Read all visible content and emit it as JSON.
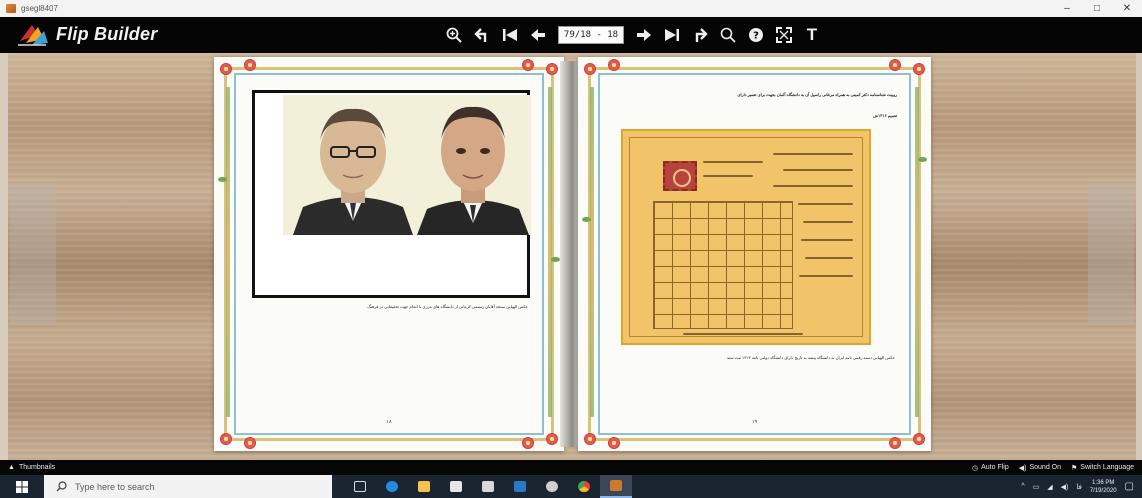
{
  "window": {
    "title": "gsegl8407",
    "minimize": "–",
    "maximize": "□",
    "close": "✕"
  },
  "toolbar": {
    "brand": "Flip Builder",
    "page_indicator": "79/18 - 18",
    "tools": [
      "zoom-in-icon",
      "back-icon",
      "first-page-icon",
      "previous-page-icon",
      "next-page-icon",
      "last-page-icon",
      "share-icon",
      "search-icon",
      "help-icon",
      "fullscreen-icon",
      "text-icon"
    ],
    "text_tool_label": "T"
  },
  "book": {
    "left_page": {
      "caption": "عکس الهیاتی سنجد آقایان رستمی کرمانی از دانشگاه های مرزی با انجام جهت تحقیقاتی در فرهنگ",
      "page_number": "۱۸"
    },
    "right_page": {
      "top_line": "روبیت شناسنامه دکتر کمینی به همراه مرغانی راسپل آن به دانشگاه آلمان بجهت برای تعمیر دارای",
      "second_line": "تعمیم ۱۳۱۶ش",
      "caption": "عکس الهیاتی دسته رقمی نامه ایران به دانشگاه پیشه به تاریخ دارای دانشگاه دولتی نامه ۱۳۱۳ ثبت سند",
      "page_number": "۱۹"
    }
  },
  "bottombar": {
    "thumbnails": "Thumbnails",
    "auto_flip": "Auto Flip",
    "sound": "Sound On",
    "language": "Switch Language"
  },
  "taskbar": {
    "search_placeholder": "Type here to search",
    "time": "1:36 PM",
    "date": "7/19/2020"
  },
  "colors": {
    "toolbar_bg": "#050505",
    "page_border_gold": "#d9c27a",
    "page_border_blue": "#8fbfd0",
    "document_paper": "#f1c469",
    "taskbar_bg": "#1b2532"
  }
}
